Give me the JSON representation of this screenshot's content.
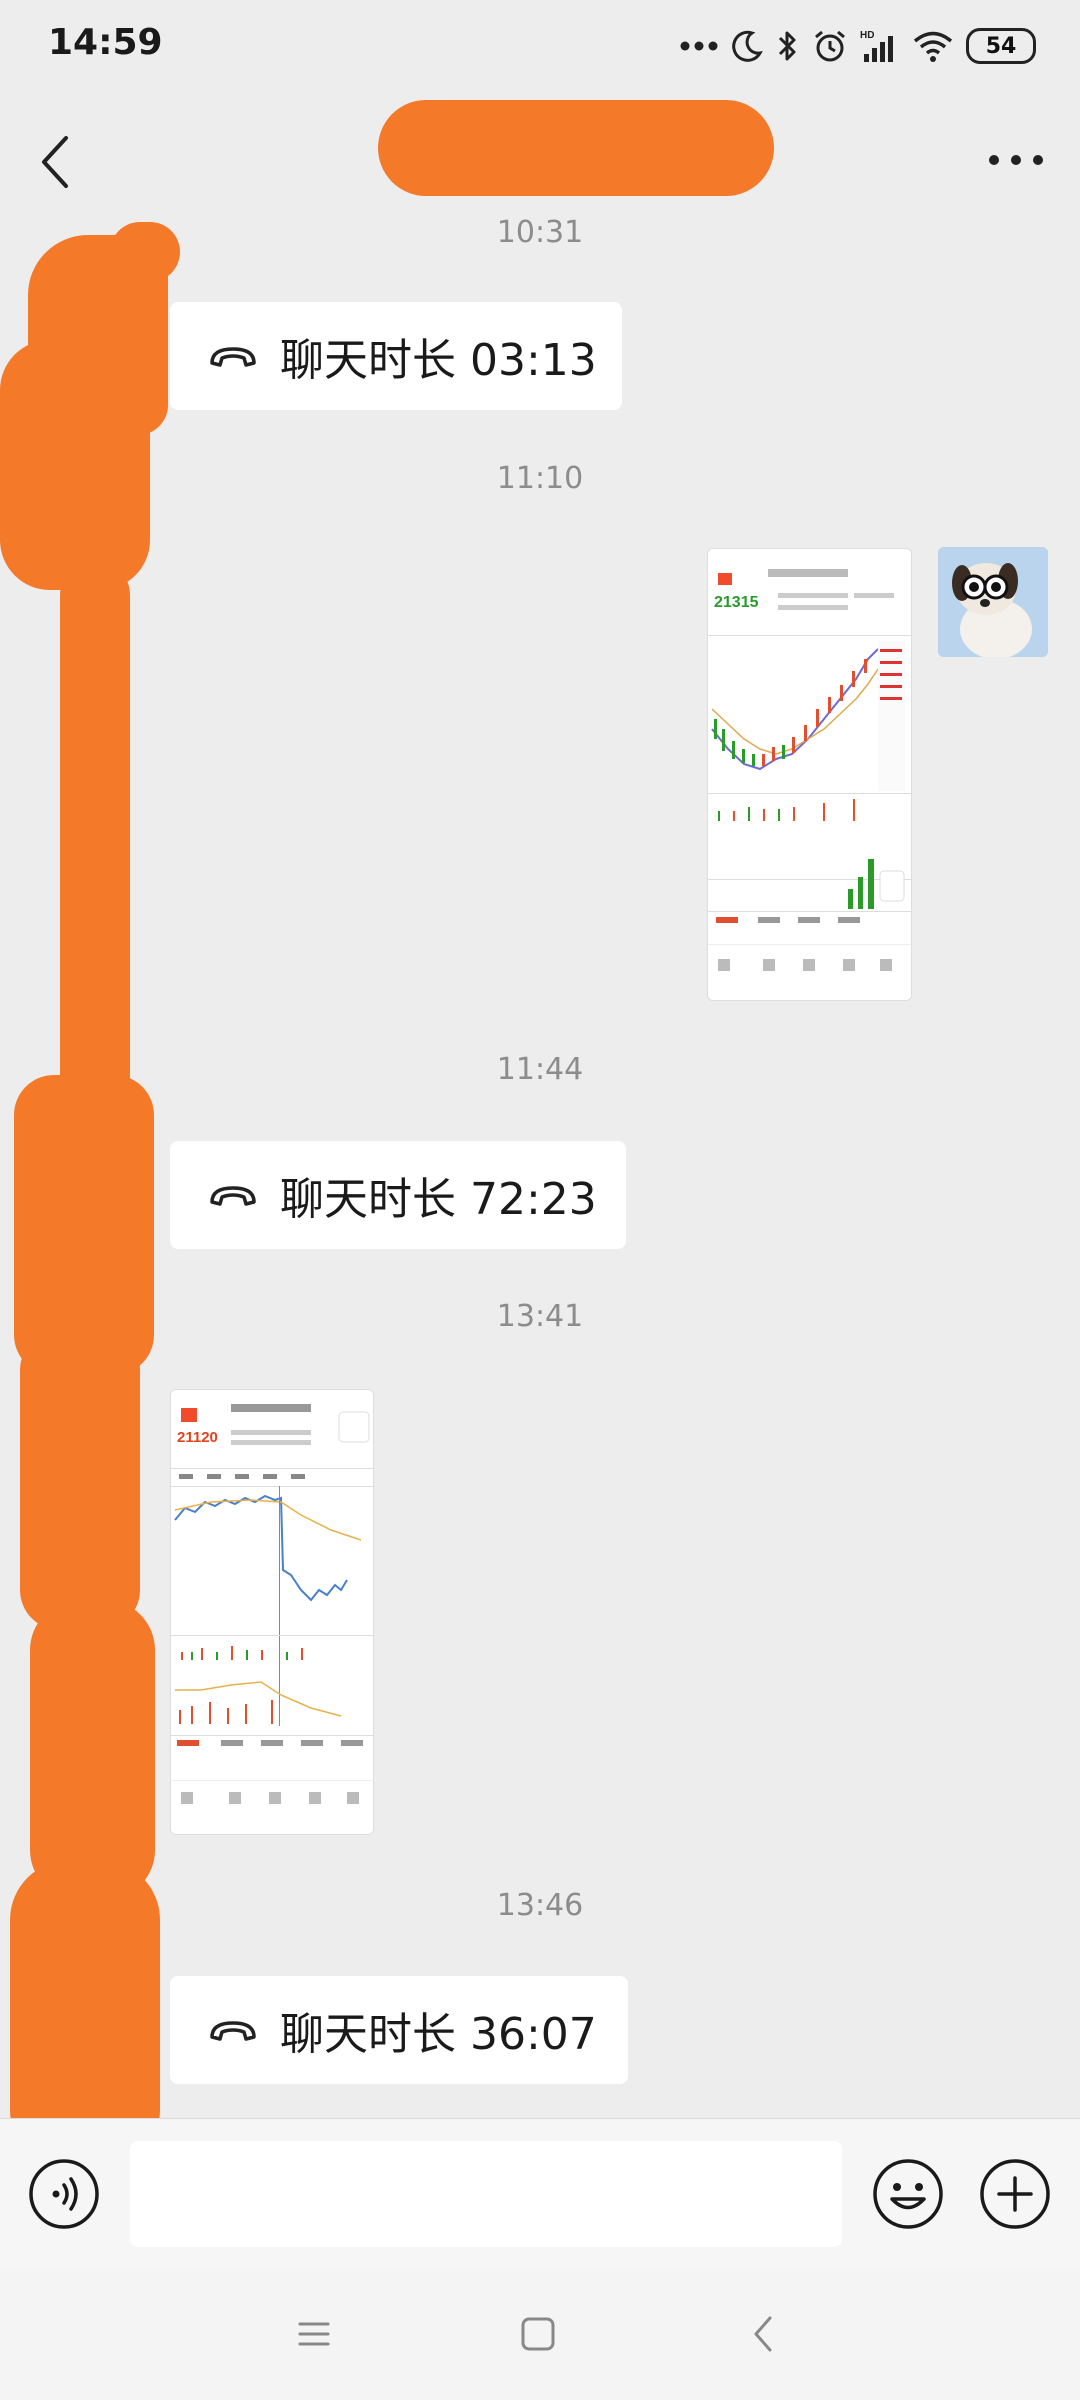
{
  "status_bar": {
    "time": "14:59",
    "battery": "54",
    "icons": [
      "more-dots-icon",
      "moon-icon",
      "bluetooth-icon",
      "alarm-icon",
      "signal-icon",
      "wifi-icon",
      "battery-icon"
    ]
  },
  "header": {
    "back_icon": "chevron-left-icon",
    "more_icon": "more-icon"
  },
  "messages": [
    {
      "type": "timestamp",
      "text": "10:31"
    },
    {
      "type": "call",
      "side": "left",
      "icon": "phone-hangup-icon",
      "text": "聊天时长 03:13"
    },
    {
      "type": "timestamp",
      "text": "11:10"
    },
    {
      "type": "image",
      "side": "right",
      "caption": "21315"
    },
    {
      "type": "timestamp",
      "text": "11:44"
    },
    {
      "type": "call",
      "side": "left",
      "icon": "phone-hangup-icon",
      "text": "聊天时长 72:23"
    },
    {
      "type": "timestamp",
      "text": "13:41"
    },
    {
      "type": "image",
      "side": "left",
      "caption": "21120"
    },
    {
      "type": "timestamp",
      "text": "13:46"
    },
    {
      "type": "call",
      "side": "left",
      "icon": "phone-hangup-icon",
      "text": "聊天时长 36:07"
    }
  ],
  "input_bar": {
    "voice_icon": "voice-icon",
    "emoji_icon": "emoji-icon",
    "plus_icon": "plus-icon"
  },
  "nav_bar": {
    "icons": [
      "menu-icon",
      "home-icon",
      "back-icon"
    ]
  },
  "colors": {
    "background": "#ededed",
    "bubble": "#ffffff",
    "redaction": "#f47a2a",
    "timestamp": "#8c8c8c"
  }
}
